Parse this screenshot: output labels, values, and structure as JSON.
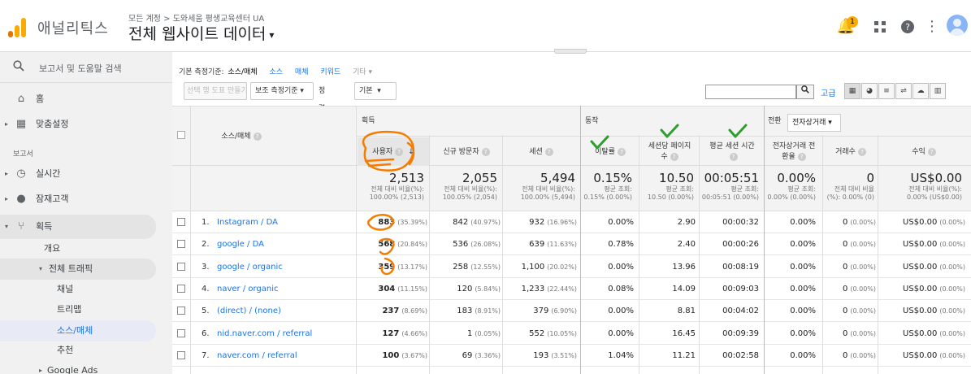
{
  "header": {
    "app_name": "애널리틱스",
    "breadcrumb": "모든 계정 > 도와세움 평생교육센터 UA",
    "view_title": "전체 웹사이트 데이터",
    "notification_count": "1"
  },
  "sidebar": {
    "search_placeholder": "보고서 및 도움말 검색",
    "home": "홈",
    "customization": "맞춤설정",
    "reports_section": "보고서",
    "realtime": "실시간",
    "audience": "잠재고객",
    "acquisition": "획득",
    "overview": "개요",
    "all_traffic": "전체 트래픽",
    "channels": "채널",
    "treemaps": "트리맵",
    "source_medium": "소스/매체",
    "referrals": "추천",
    "google_ads": "Google Ads"
  },
  "toolbar": {
    "primary_dim_label": "기본 측정기준:",
    "primary_dim_current": "소스/매체",
    "dim_source": "소스",
    "dim_medium": "매체",
    "dim_keyword": "키워드",
    "dim_other": "기타",
    "plot_rows": "선택 행 도표 만들기",
    "secondary_dim": "보조 측정기준",
    "sort_label": "정렬 유형:",
    "sort_value": "기본",
    "advanced": "고급"
  },
  "table": {
    "col_source": "소스/매체",
    "group_acquisition": "획득",
    "group_behavior": "동작",
    "group_conversions": "전환",
    "conversion_select": "전자상거래",
    "col_users": "사용자",
    "col_new_users": "신규 방문자",
    "col_sessions": "세션",
    "col_bounce": "이탈률",
    "col_pages_session_1": "세션당 페이지",
    "col_pages_session_2": "수",
    "col_avg_duration": "평균 세션 시간",
    "col_ecom_rate_1": "전자상거래 전",
    "col_ecom_rate_2": "환율",
    "col_transactions": "거래수",
    "col_revenue": "수익",
    "summary": {
      "users": "2,513",
      "users_sub1": "전체 대비 비율(%):",
      "users_sub2": "100.00% (2,513)",
      "new_users": "2,055",
      "new_users_sub1": "전체 대비 비율(%):",
      "new_users_sub2": "100.05% (2,054)",
      "sessions": "5,494",
      "sessions_sub1": "전체 대비 비율(%):",
      "sessions_sub2": "100.00% (5,494)",
      "bounce": "0.15%",
      "bounce_sub1": "평균 조회:",
      "bounce_sub2": "0.15% (0.00%)",
      "pages": "10.50",
      "pages_sub1": "평균 조회:",
      "pages_sub2": "10.50 (0.00%)",
      "duration": "00:05:51",
      "duration_sub1": "평균 조회:",
      "duration_sub2": "00:05:51 (0.00%)",
      "ecom": "0.00%",
      "ecom_sub1": "평균 조회:",
      "ecom_sub2": "0.00% (0.00%)",
      "trans": "0",
      "trans_sub1": "전체 대비 비율",
      "trans_sub2": "(%): 0.00% (0)",
      "revenue": "US$0.00",
      "revenue_sub1": "전체 대비 비율(%):",
      "revenue_sub2": "0.00% (US$0.00)"
    },
    "rows": [
      {
        "n": "1.",
        "src": "Instagram / DA",
        "users": "883",
        "users_pct": "(35.39%)",
        "new": "842",
        "new_pct": "(40.97%)",
        "sess": "932",
        "sess_pct": "(16.96%)",
        "bounce": "0.00%",
        "pages": "2.90",
        "dur": "00:00:32",
        "ecom": "0.00%",
        "trans": "0",
        "trans_pct": "(0.00%)",
        "rev": "US$0.00",
        "rev_pct": "(0.00%)"
      },
      {
        "n": "2.",
        "src": "google / DA",
        "users": "568",
        "users_pct": "(20.84%)",
        "new": "536",
        "new_pct": "(26.08%)",
        "sess": "639",
        "sess_pct": "(11.63%)",
        "bounce": "0.78%",
        "pages": "2.40",
        "dur": "00:00:26",
        "ecom": "0.00%",
        "trans": "0",
        "trans_pct": "(0.00%)",
        "rev": "US$0.00",
        "rev_pct": "(0.00%)"
      },
      {
        "n": "3.",
        "src": "google / organic",
        "users": "359",
        "users_pct": "(13.17%)",
        "new": "258",
        "new_pct": "(12.55%)",
        "sess": "1,100",
        "sess_pct": "(20.02%)",
        "bounce": "0.00%",
        "pages": "13.96",
        "dur": "00:08:19",
        "ecom": "0.00%",
        "trans": "0",
        "trans_pct": "(0.00%)",
        "rev": "US$0.00",
        "rev_pct": "(0.00%)"
      },
      {
        "n": "4.",
        "src": "naver / organic",
        "users": "304",
        "users_pct": "(11.15%)",
        "new": "120",
        "new_pct": "(5.84%)",
        "sess": "1,233",
        "sess_pct": "(22.44%)",
        "bounce": "0.08%",
        "pages": "14.09",
        "dur": "00:09:03",
        "ecom": "0.00%",
        "trans": "0",
        "trans_pct": "(0.00%)",
        "rev": "US$0.00",
        "rev_pct": "(0.00%)"
      },
      {
        "n": "5.",
        "src": "(direct) / (none)",
        "users": "237",
        "users_pct": "(8.69%)",
        "new": "183",
        "new_pct": "(8.91%)",
        "sess": "379",
        "sess_pct": "(6.90%)",
        "bounce": "0.00%",
        "pages": "8.81",
        "dur": "00:04:02",
        "ecom": "0.00%",
        "trans": "0",
        "trans_pct": "(0.00%)",
        "rev": "US$0.00",
        "rev_pct": "(0.00%)"
      },
      {
        "n": "6.",
        "src": "nid.naver.com / referral",
        "users": "127",
        "users_pct": "(4.66%)",
        "new": "1",
        "new_pct": "(0.05%)",
        "sess": "552",
        "sess_pct": "(10.05%)",
        "bounce": "0.00%",
        "pages": "16.45",
        "dur": "00:09:39",
        "ecom": "0.00%",
        "trans": "0",
        "trans_pct": "(0.00%)",
        "rev": "US$0.00",
        "rev_pct": "(0.00%)"
      },
      {
        "n": "7.",
        "src": "naver.com / referral",
        "users": "100",
        "users_pct": "(3.67%)",
        "new": "69",
        "new_pct": "(3.36%)",
        "sess": "193",
        "sess_pct": "(3.51%)",
        "bounce": "1.04%",
        "pages": "11.21",
        "dur": "00:02:58",
        "ecom": "0.00%",
        "trans": "0",
        "trans_pct": "(0.00%)",
        "rev": "US$0.00",
        "rev_pct": "(0.00%)"
      }
    ]
  },
  "colors": {
    "accent": "#1a73e8",
    "annotation_orange": "#f57c00",
    "annotation_green": "#2e9e2e",
    "logo_orange": "#f9ab00",
    "logo_dark": "#e37400"
  },
  "icons": {
    "search": "search-icon",
    "home": "home-icon",
    "dashboard": "dashboard-icon",
    "clock": "clock-icon",
    "person": "person-icon",
    "acquisition": "acquisition-icon",
    "bell": "bell-icon",
    "apps": "apps-icon",
    "help": "help-icon",
    "more": "more-vert-icon",
    "avatar": "avatar"
  }
}
